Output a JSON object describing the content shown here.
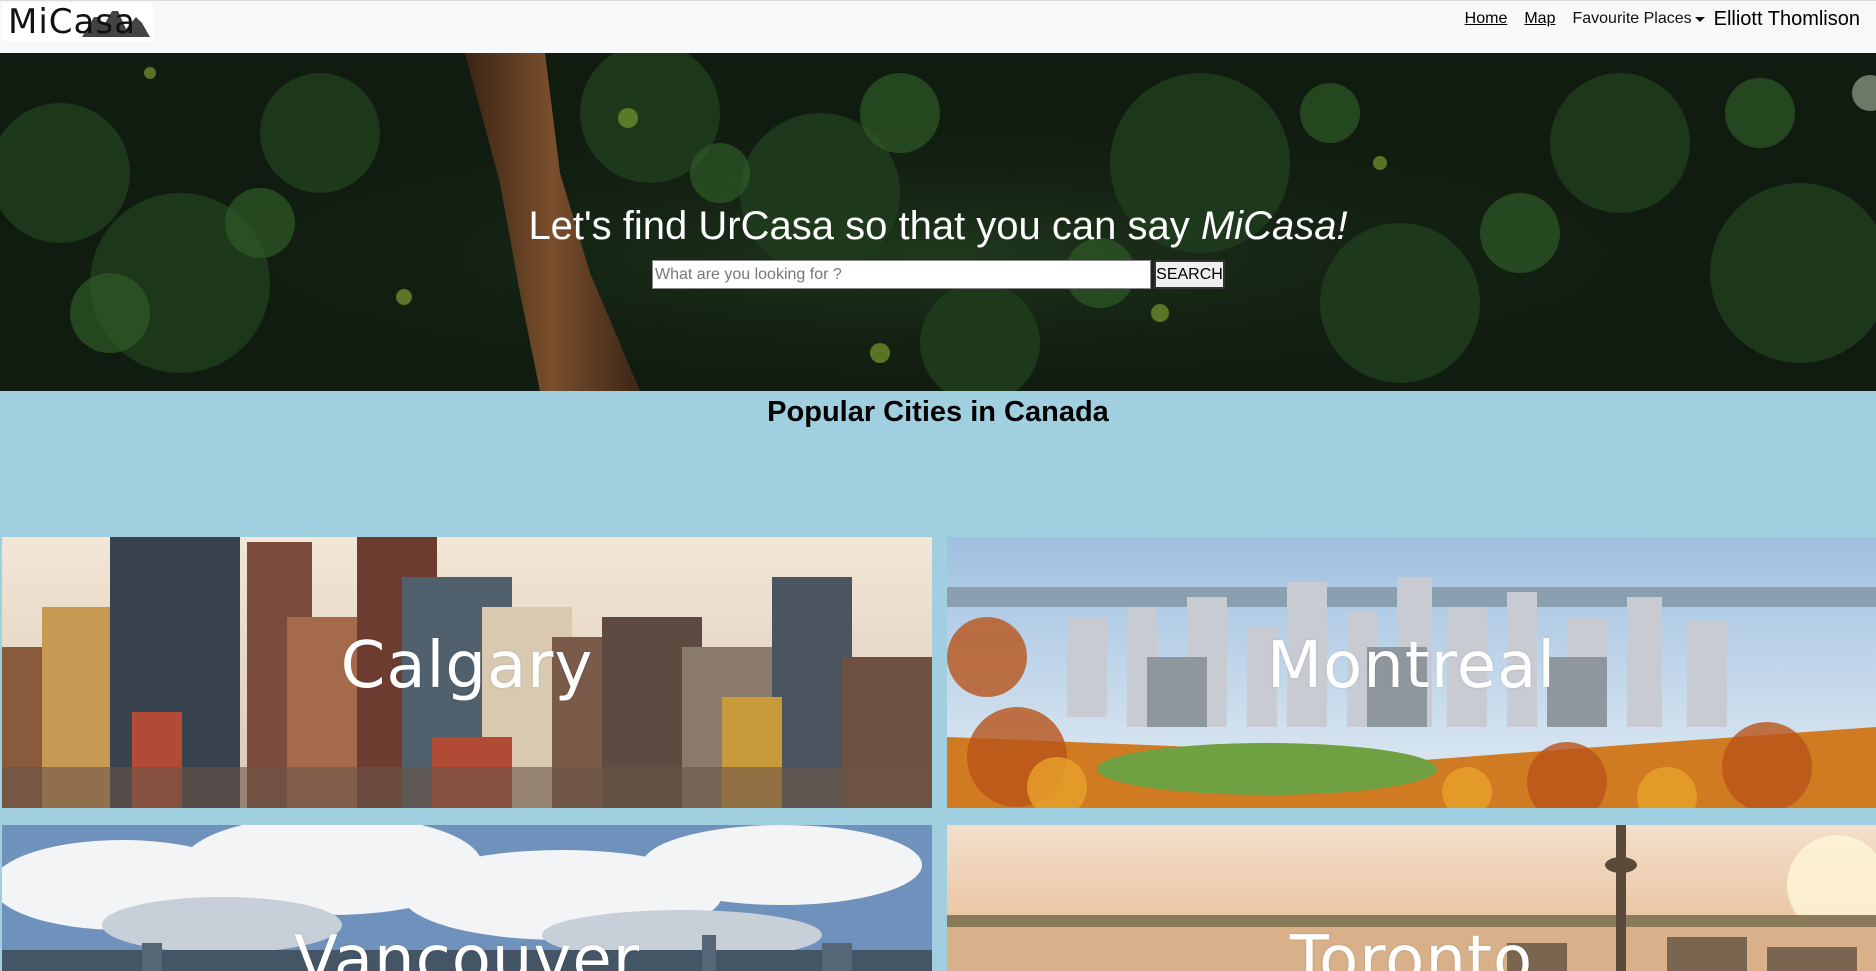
{
  "brand": {
    "logo_text": "MiCasa"
  },
  "nav": {
    "home": "Home",
    "map": "Map",
    "favourites": "Favourite Places",
    "user": "Elliott Thomlison"
  },
  "hero": {
    "title_prefix": "Let's find UrCasa so that you can say ",
    "title_emphasis": "MiCasa!",
    "search_placeholder": "What are you looking for ?",
    "search_button": "SEARCH"
  },
  "section": {
    "title": "Popular Cities in Canada"
  },
  "cities": [
    {
      "name": "Calgary"
    },
    {
      "name": "Montreal"
    },
    {
      "name": "Vancouver"
    },
    {
      "name": "Toronto"
    }
  ],
  "colors": {
    "page_background": "#a0cfe0",
    "navbar": "#f7f8f9",
    "hero_foliage": "#1d3a1c"
  }
}
